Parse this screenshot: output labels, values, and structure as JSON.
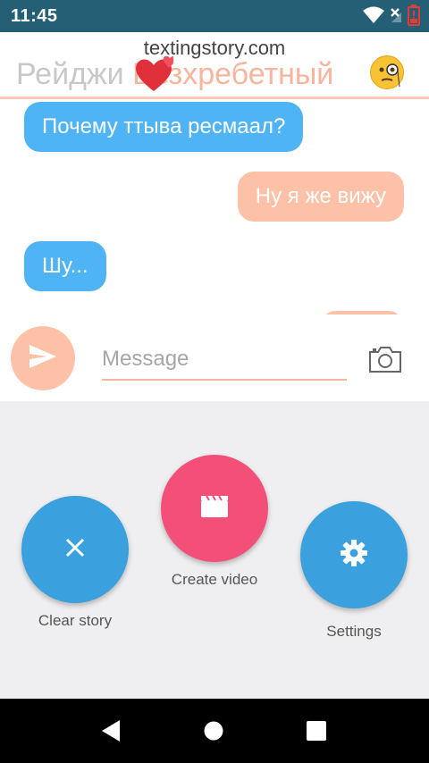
{
  "status_bar": {
    "time": "11:45",
    "icons": [
      "wifi-icon",
      "no-signal-icon",
      "battery-low-icon"
    ],
    "battery_color": "#e53935"
  },
  "chat": {
    "watermark": "textingstory.com",
    "contact": {
      "first_name": "Рейджи",
      "last_name": "Безхребетный",
      "emojis": [
        "heart-emoji",
        "monocle-face-emoji"
      ]
    },
    "messages": [
      {
        "side": "left",
        "text": "Почему ттыва ресмаал?"
      },
      {
        "side": "right",
        "text": "Ну я же вижу"
      },
      {
        "side": "left",
        "text": "Шу..."
      },
      {
        "side": "right",
        "text": ""
      }
    ],
    "colors": {
      "left_bubble": "#4fb4f5",
      "right_bubble": "#fcc1a7",
      "accent": "#f6b59c"
    }
  },
  "composer": {
    "placeholder": "Message",
    "send_icon": "send-icon",
    "camera_icon": "camera-icon"
  },
  "actions": {
    "clear_story": {
      "label": "Clear story",
      "icon": "close-icon",
      "color": "#3aa0de"
    },
    "create_video": {
      "label": "Create video",
      "icon": "clapperboard-icon",
      "color": "#f34f79"
    },
    "settings": {
      "label": "Settings",
      "icon": "gear-icon",
      "color": "#3aa0de"
    }
  },
  "nav_bar": {
    "buttons": [
      "back-icon",
      "home-icon",
      "recents-icon"
    ]
  }
}
